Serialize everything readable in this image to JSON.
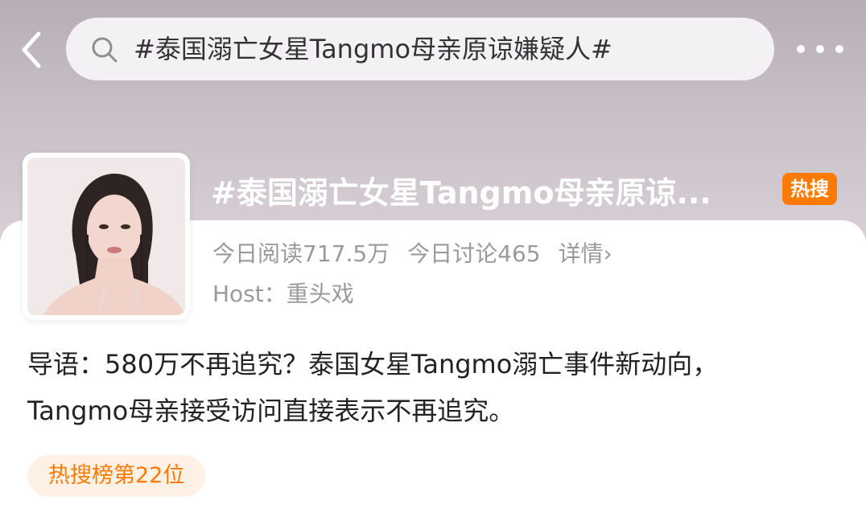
{
  "search": {
    "query": "#泰国溺亡女星Tangmo母亲原谅嫌疑人#"
  },
  "topic": {
    "title": "#泰国溺亡女星Tangmo母亲原谅...",
    "badge": "热搜",
    "read_label": "今日阅读717.5万",
    "discuss_label": "今日讨论465",
    "details_label": "详情›",
    "host_label": "Host：",
    "host_name": "重头戏"
  },
  "intro": {
    "line1": "导语：580万不再追究？泰国女星Tangmo溺亡事件新动向，",
    "line2": "Tangmo母亲接受访问直接表示不再追究。"
  },
  "rank": {
    "label": "热搜榜第22位"
  },
  "icons": {
    "back": "chevron-left-icon",
    "search": "search-icon",
    "more": "more-dots-icon"
  },
  "colors": {
    "accent": "#ff7a00",
    "rank_bg": "#fff1e6"
  }
}
